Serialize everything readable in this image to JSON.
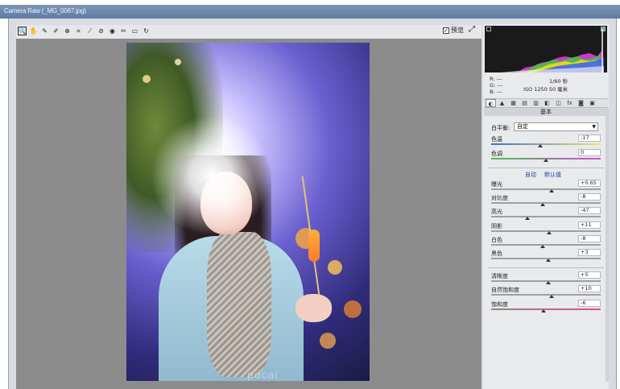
{
  "window": {
    "title": "Camera Raw (_MG_0067.jpg)"
  },
  "toolbar": {
    "tools": [
      {
        "name": "zoom-tool-icon",
        "glyph": "🔍"
      },
      {
        "name": "hand-tool-icon",
        "glyph": "✋"
      },
      {
        "name": "white-balance-tool-icon",
        "glyph": "✎"
      },
      {
        "name": "color-sampler-tool-icon",
        "glyph": "✐"
      },
      {
        "name": "target-adjustment-tool-icon",
        "glyph": "⊕"
      },
      {
        "name": "crop-tool-icon",
        "glyph": "⌗"
      },
      {
        "name": "straighten-tool-icon",
        "glyph": "⟋"
      },
      {
        "name": "spot-removal-tool-icon",
        "glyph": "⊘"
      },
      {
        "name": "red-eye-tool-icon",
        "glyph": "◉"
      },
      {
        "name": "adjustment-brush-icon",
        "glyph": "✏"
      },
      {
        "name": "graduated-filter-icon",
        "glyph": "▭"
      },
      {
        "name": "rotate-icon",
        "glyph": "↻"
      }
    ],
    "preview_label": "预览",
    "preview_checked": "✓"
  },
  "photo": {
    "watermark": "pocai"
  },
  "histogram": {
    "colors": [
      "#ff3b3b",
      "#ffe600",
      "#39d03a",
      "#3b5bff",
      "#ff3bff",
      "#ffffff"
    ]
  },
  "info": {
    "rgb_r": "R: ---",
    "rgb_g": "G: ---",
    "rgb_b": "B: ---",
    "shutter": "1/60 秒",
    "iso_focal": "ISO 1250   50 毫米"
  },
  "panel": {
    "section_title": "基本",
    "white_balance": {
      "label": "白平衡:",
      "value": "自定"
    },
    "auto_label": "自动",
    "default_label": "默认值",
    "sliders": [
      {
        "key": "temperature",
        "label": "色温",
        "value": "-17",
        "pos": 0.45
      },
      {
        "key": "tint",
        "label": "色调",
        "value": "0",
        "pos": 0.5
      },
      {
        "key": "exposure",
        "label": "曝光",
        "value": "+0.65",
        "pos": 0.55
      },
      {
        "key": "contrast",
        "label": "对比度",
        "value": "-8",
        "pos": 0.47
      },
      {
        "key": "highlights",
        "label": "高光",
        "value": "-47",
        "pos": 0.33
      },
      {
        "key": "shadows",
        "label": "阴影",
        "value": "+11",
        "pos": 0.53
      },
      {
        "key": "whites",
        "label": "白色",
        "value": "-8",
        "pos": 0.47
      },
      {
        "key": "blacks",
        "label": "黑色",
        "value": "+3",
        "pos": 0.52
      },
      {
        "key": "clarity",
        "label": "清晰度",
        "value": "+5",
        "pos": 0.52
      },
      {
        "key": "vibrance",
        "label": "自然饱和度",
        "value": "+10",
        "pos": 0.55
      },
      {
        "key": "saturation",
        "label": "饱和度",
        "value": "-6",
        "pos": 0.48
      }
    ],
    "tabs": [
      "◐",
      "▲",
      "▦",
      "▤",
      "▥",
      "◧",
      "◫",
      "fx",
      "◙",
      "▣"
    ]
  }
}
